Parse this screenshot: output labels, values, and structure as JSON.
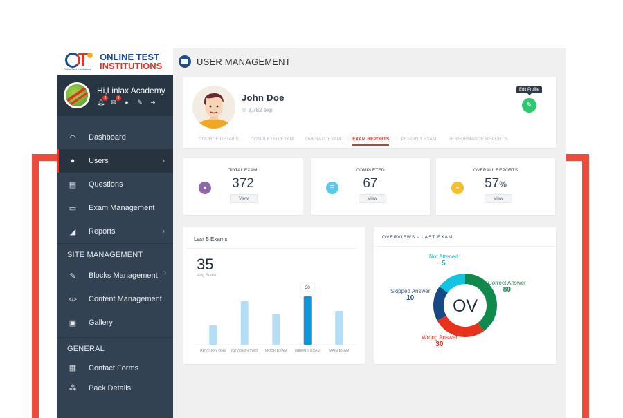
{
  "brand": {
    "logo_sub": "OnlineTest-Institutions",
    "line1": "ONLINE TEST",
    "line2": "INSTITUTIONS"
  },
  "header": {
    "title": "USER MANAGEMENT",
    "icon": "list-icon"
  },
  "sidebar": {
    "greeting": "Hi,Linlax Academy",
    "notifications_badge": "8",
    "messages_badge": "8",
    "items": [
      {
        "label": "Dashboard",
        "icon": "dashboard-icon",
        "glyph": "◠"
      },
      {
        "label": "Users",
        "icon": "user-icon",
        "glyph": "●",
        "active": true,
        "chevron": "›"
      },
      {
        "label": "Questions",
        "icon": "book-icon",
        "glyph": "▤"
      },
      {
        "label": "Exam Management",
        "icon": "laptop-icon",
        "glyph": "▭"
      },
      {
        "label": "Reports",
        "icon": "area-chart-icon",
        "glyph": "◢",
        "chevron": "›"
      }
    ],
    "site_section": "SITE MANAGEMENT",
    "site_items": [
      {
        "label": "Blocks Management",
        "icon": "edit-icon",
        "glyph": "✎",
        "chevron": "›"
      },
      {
        "label": "Content Management",
        "icon": "code-icon",
        "glyph": "</>"
      },
      {
        "label": "Gallery",
        "icon": "image-icon",
        "glyph": "▣"
      }
    ],
    "general_section": "GENERAL",
    "general_items": [
      {
        "label": "Contact Forms",
        "icon": "form-icon",
        "glyph": "▦"
      },
      {
        "label": "Pack Details",
        "icon": "cubes-icon",
        "glyph": "⁂"
      }
    ]
  },
  "profile": {
    "name": "John Doe",
    "exp": "8,782 exp",
    "edit_tooltip": "Edit Profile",
    "edit_glyph": "✎",
    "tabs": [
      {
        "label": "COURCE DETAILS"
      },
      {
        "label": "COMPLETED EXAM"
      },
      {
        "label": "OVERALL EXAM"
      },
      {
        "label": "EXAM REPORTS",
        "active": true
      },
      {
        "label": "PENDING EXAM"
      },
      {
        "label": "PERFORMANCE REPORTS"
      }
    ]
  },
  "stats": [
    {
      "label": "TOTAL EXAM",
      "value": "372",
      "unit": "",
      "button": "View",
      "icon": "microphone-icon",
      "glyph": "🎙",
      "color": "#8f68aa"
    },
    {
      "label": "COMPLETED",
      "value": "67",
      "unit": "",
      "button": "View",
      "icon": "list-icon",
      "glyph": "☰",
      "color": "#5ac8ea"
    },
    {
      "label": "OVERALL REPORTS",
      "value": "57",
      "unit": "%",
      "button": "View",
      "icon": "link-icon",
      "glyph": "⚭",
      "color": "#f2c02f"
    }
  ],
  "chart_data": [
    {
      "type": "bar",
      "title": "Last 5 Exams",
      "summary_value": "35",
      "summary_label": "Avg Score",
      "categories": [
        "REVISION ONE",
        "REVISION TWO",
        "MOCK EXAM",
        "WEEKLY EXAM",
        "MAIN EXAM"
      ],
      "values": [
        12,
        27,
        19,
        30,
        21
      ],
      "highlight_index": 3,
      "tooltip": "30",
      "ylim": [
        0,
        30
      ],
      "colors": {
        "normal": "#b5ddf4",
        "highlight": "#0d96de"
      },
      "xlabel": "",
      "ylabel": "",
      "grid": false
    },
    {
      "type": "pie",
      "title": "OVERVIEWS - LAST EXAM",
      "center_label": "OV",
      "slices": [
        {
          "label": "Correct Answer",
          "value": 80,
          "arc_share": 0.4,
          "color": "#0f8a4c"
        },
        {
          "label": "Wrong Answer",
          "value": 30,
          "arc_share": 0.27,
          "color": "#e8321b"
        },
        {
          "label": "Skipped Answer",
          "value": 10,
          "arc_share": 0.18,
          "color": "#174985"
        },
        {
          "label": "Not Attened",
          "value": 5,
          "arc_share": 0.15,
          "color": "#12c3e2"
        }
      ]
    }
  ]
}
